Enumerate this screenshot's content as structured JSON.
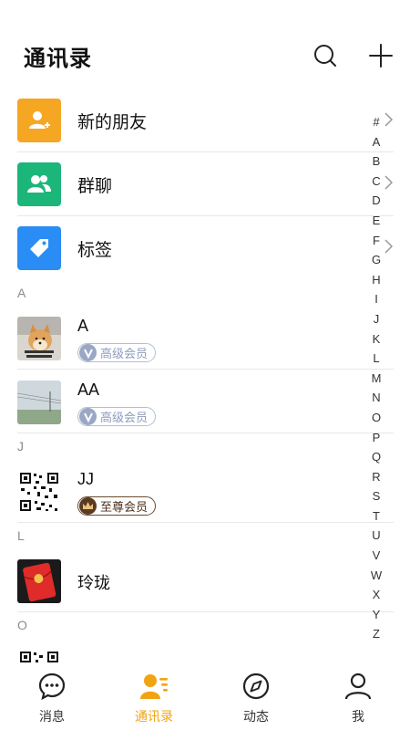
{
  "header": {
    "title": "通讯录",
    "search_icon": "search-icon",
    "add_icon": "plus-icon"
  },
  "functions": [
    {
      "label": "新的朋友",
      "icon": "add-friend-icon",
      "color": "#f5a623"
    },
    {
      "label": "群聊",
      "icon": "group-icon",
      "color": "#1db67a"
    },
    {
      "label": "标签",
      "icon": "tag-icon",
      "color": "#2a8cf5"
    }
  ],
  "sections": [
    {
      "letter": "A",
      "contacts": [
        {
          "name": "A",
          "badge": "高级会员",
          "badge_type": "senior",
          "avatar": "shiba-dog-photo"
        },
        {
          "name": "AA",
          "badge": "高级会员",
          "badge_type": "senior",
          "avatar": "landscape-photo"
        }
      ]
    },
    {
      "letter": "J",
      "contacts": [
        {
          "name": "JJ",
          "badge": "至尊会员",
          "badge_type": "supreme",
          "avatar": "qr-code"
        }
      ]
    },
    {
      "letter": "L",
      "contacts": [
        {
          "name": "玲珑",
          "badge": "",
          "avatar": "red-envelope"
        }
      ]
    },
    {
      "letter": "O",
      "contacts": [
        {
          "name": "",
          "badge": "",
          "avatar": "qr-code"
        }
      ]
    }
  ],
  "index_letters": [
    "#",
    "A",
    "B",
    "C",
    "D",
    "E",
    "F",
    "G",
    "H",
    "I",
    "J",
    "K",
    "L",
    "M",
    "N",
    "O",
    "P",
    "Q",
    "R",
    "S",
    "T",
    "U",
    "V",
    "W",
    "X",
    "Y",
    "Z"
  ],
  "tabs": [
    {
      "label": "消息",
      "icon": "chat-bubble-icon",
      "active": false
    },
    {
      "label": "通讯录",
      "icon": "contacts-icon",
      "active": true
    },
    {
      "label": "动态",
      "icon": "compass-icon",
      "active": false
    },
    {
      "label": "我",
      "icon": "person-icon",
      "active": false
    }
  ],
  "colors": {
    "accent": "#f2a314",
    "divider": "#e8e8e8"
  }
}
